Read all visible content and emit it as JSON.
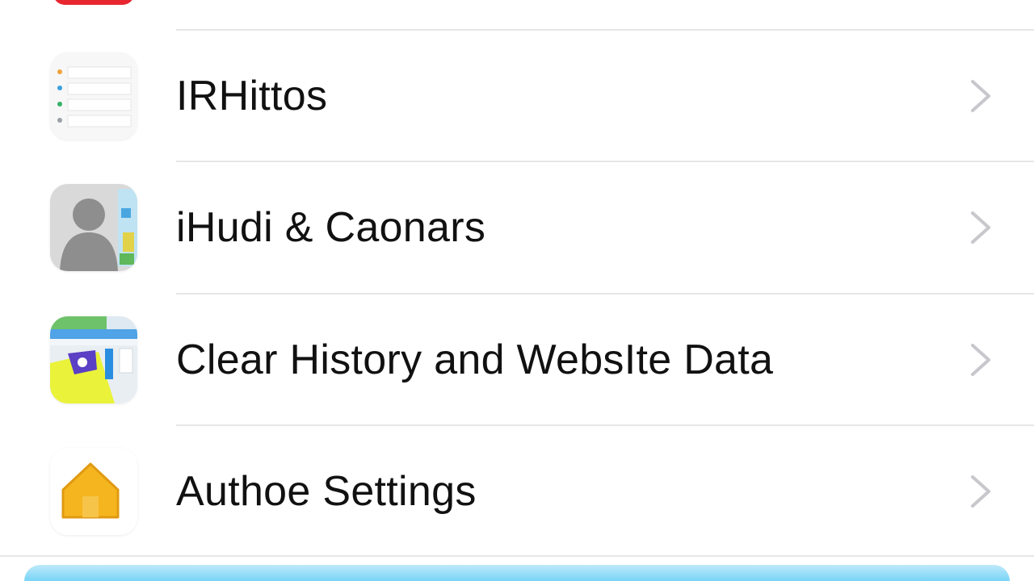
{
  "settings_list": {
    "items": [
      {
        "label": "IRHittos",
        "icon": "notes-list-icon"
      },
      {
        "label": "iHudi & Caonars",
        "icon": "contact-photo-icon"
      },
      {
        "label": "Clear History and WebsIte Data",
        "icon": "map-app-icon"
      },
      {
        "label": "Authoe Settings",
        "icon": "home-icon"
      }
    ]
  },
  "colors": {
    "top_icon": "#e8262f",
    "chevron": "#c7c7cc",
    "separator": "#e6e6e6",
    "bottom_bar": "#5ccaf3"
  }
}
